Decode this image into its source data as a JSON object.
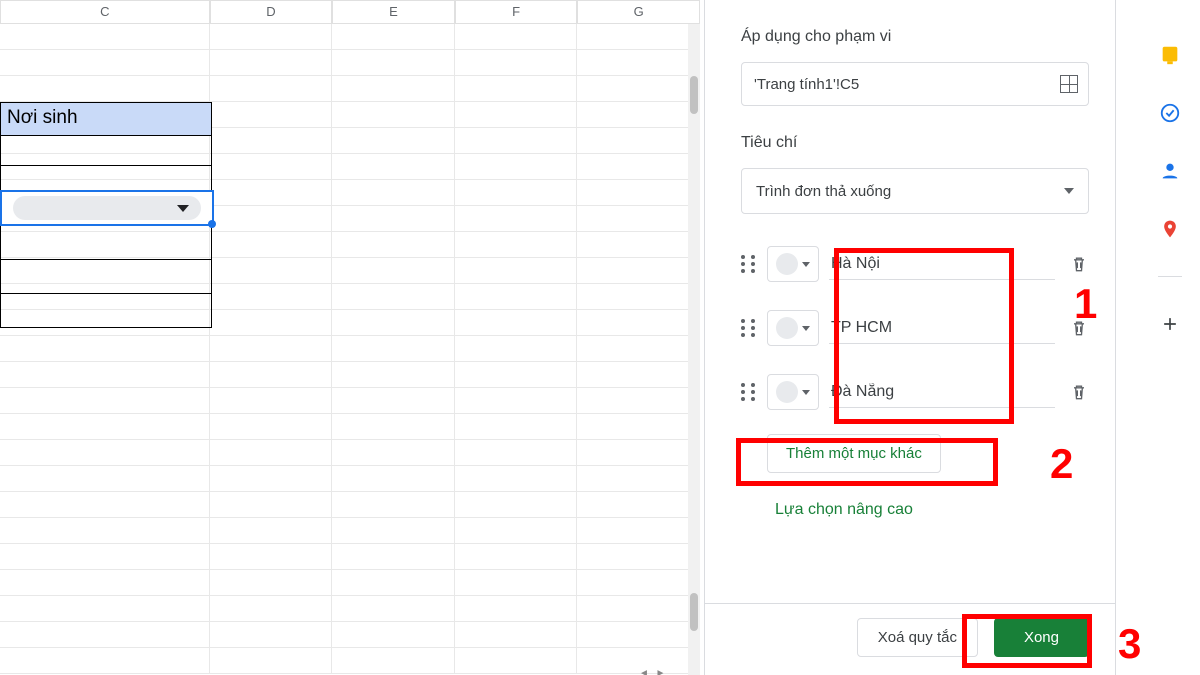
{
  "columns": [
    "C",
    "D",
    "E",
    "F",
    "G"
  ],
  "header_cell": "Nơi sinh",
  "panel": {
    "range_label": "Áp dụng cho phạm vi",
    "range_value": "'Trang tính1'!C5",
    "criteria_label": "Tiêu chí",
    "criteria_value": "Trình đơn thả xuống",
    "options": [
      "Hà Nội",
      "TP HCM",
      "Đà Nẵng"
    ],
    "add_item": "Thêm một mục khác",
    "advanced": "Lựa chọn nâng cao",
    "remove_rule": "Xoá quy tắc",
    "done": "Xong"
  },
  "annotations": {
    "one": "1",
    "two": "2",
    "three": "3"
  }
}
